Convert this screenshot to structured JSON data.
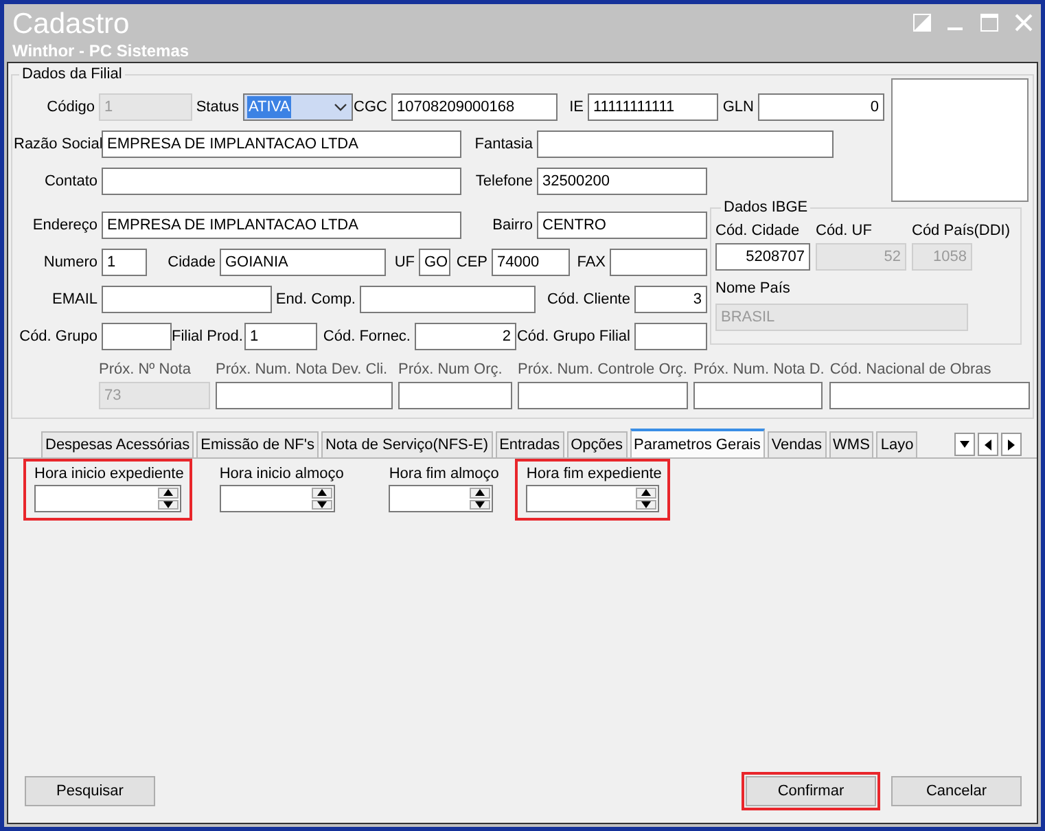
{
  "window": {
    "title": "Cadastro",
    "subtitle": "Winthor - PC Sistemas"
  },
  "branch_group": {
    "title": "Dados da Filial",
    "fields": [
      {
        "label": "Código",
        "value": "1",
        "kind": "text",
        "disabled": true
      },
      {
        "label": "Status",
        "value": "ATIVA",
        "kind": "select",
        "disabled": false
      },
      {
        "label": "CGC",
        "value": "10708209000168",
        "kind": "text",
        "disabled": false
      },
      {
        "label": "IE",
        "value": "11111111111",
        "kind": "text",
        "disabled": false
      },
      {
        "label": "GLN",
        "value": "0",
        "kind": "number",
        "disabled": false
      },
      {
        "label": "Razão Social",
        "value": "EMPRESA DE IMPLANTACAO LTDA",
        "kind": "text",
        "disabled": false
      },
      {
        "label": "Fantasia",
        "kind": "text",
        "disabled": false
      },
      {
        "label": "Contato",
        "kind": "text",
        "disabled": false
      },
      {
        "label": "Telefone",
        "value": "32500200",
        "kind": "text",
        "disabled": false
      },
      {
        "label": "Endereço",
        "value": "EMPRESA DE IMPLANTACAO LTDA",
        "kind": "text",
        "disabled": false
      },
      {
        "label": "Bairro",
        "value": "CENTRO",
        "kind": "text",
        "disabled": false
      },
      {
        "label": "Numero",
        "value": "1",
        "kind": "text",
        "disabled": false
      },
      {
        "label": "Cidade",
        "value": "GOIANIA",
        "kind": "text",
        "disabled": false
      },
      {
        "label": "UF",
        "value": "GO",
        "kind": "text",
        "disabled": false
      },
      {
        "label": "CEP",
        "value": "74000",
        "kind": "text",
        "disabled": false
      },
      {
        "label": "FAX",
        "kind": "text",
        "disabled": false
      },
      {
        "label": "EMAIL",
        "kind": "text",
        "disabled": false
      },
      {
        "label": "End. Comp.",
        "kind": "text",
        "disabled": false
      },
      {
        "label": "Cód. Cliente",
        "value": "3",
        "kind": "number",
        "disabled": false
      },
      {
        "label": "Cód. Grupo",
        "kind": "text",
        "disabled": false
      },
      {
        "label": "Filial Prod.",
        "value": "1",
        "kind": "text",
        "disabled": false
      },
      {
        "label": "Cód. Fornec.",
        "value": "2",
        "kind": "number",
        "disabled": false
      },
      {
        "label": "Cód. Grupo Filial",
        "kind": "text",
        "disabled": false
      }
    ],
    "next_numbers": [
      {
        "label": "Próx. Nº Nota",
        "value": "73",
        "disabled": true
      },
      {
        "label": "Próx. Num. Nota Dev. Cli.",
        "disabled": false
      },
      {
        "label": "Próx. Num Orç.",
        "disabled": false
      },
      {
        "label": "Próx. Num. Controle Orç.",
        "disabled": false
      },
      {
        "label": "Próx. Num. Nota D.",
        "disabled": false
      },
      {
        "label": "Cód. Nacional de Obras",
        "disabled": false
      }
    ],
    "ibge": {
      "title": "Dados IBGE",
      "fields": [
        {
          "label": "Cód. Cidade",
          "value": "5208707",
          "disabled": false
        },
        {
          "label": "Cód. UF",
          "value": "52",
          "disabled": true
        },
        {
          "label": "Cód País(DDI)",
          "value": "1058",
          "disabled": true
        },
        {
          "label": "Nome País",
          "value": "BRASIL",
          "disabled": true
        }
      ]
    }
  },
  "tabs": [
    {
      "label": "Despesas Acessórias",
      "selected": false
    },
    {
      "label": "Emissão de NF's",
      "selected": false
    },
    {
      "label": "Nota de Serviço(NFS-E)",
      "selected": false
    },
    {
      "label": "Entradas",
      "selected": false
    },
    {
      "label": "Opções",
      "selected": false
    },
    {
      "label": "Parametros Gerais",
      "selected": true
    },
    {
      "label": "Vendas",
      "selected": false
    },
    {
      "label": "WMS",
      "selected": false
    },
    {
      "label": "Layo",
      "selected": false
    }
  ],
  "time_fields": [
    {
      "label": "Hora inicio expediente",
      "highlighted": true
    },
    {
      "label": "Hora inicio almoço",
      "highlighted": false
    },
    {
      "label": "Hora fim almoço",
      "highlighted": false
    },
    {
      "label": "Hora fim expediente",
      "highlighted": true
    }
  ],
  "buttons": [
    {
      "label": "Pesquisar",
      "highlighted": false
    },
    {
      "label": "Confirmar",
      "highlighted": true
    },
    {
      "label": "Cancelar",
      "highlighted": false
    }
  ]
}
